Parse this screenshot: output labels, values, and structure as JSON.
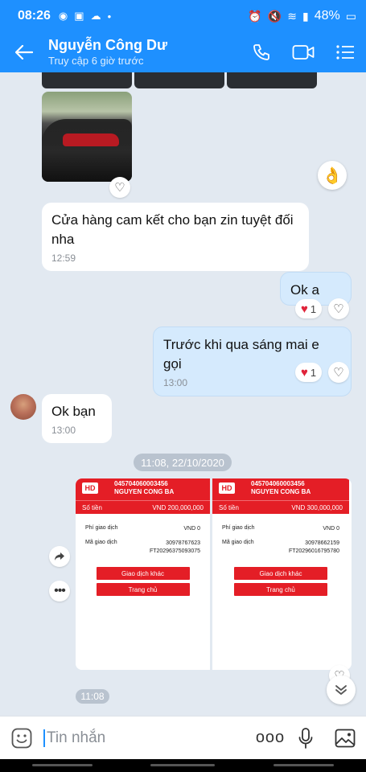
{
  "status_bar": {
    "time": "08:26",
    "battery": "48%"
  },
  "header": {
    "name": "Nguyễn Công Dư",
    "subtitle": "Truy cập 6 giờ trước"
  },
  "messages": [
    {
      "text": "Cửa hàng cam kết cho bạn zin tuyệt đối nha",
      "time": "12:59"
    },
    {
      "text": "Ok a",
      "reaction_count": "1"
    },
    {
      "text": "Trước khi qua sáng mai e gọi",
      "time": "13:00",
      "reaction_count": "1"
    },
    {
      "text": "Ok bạn",
      "time": "13:00"
    }
  ],
  "date_separator": "11:08, 22/10/2020",
  "receipts": [
    {
      "badge": "HD",
      "account": "045704060003456",
      "account_name": "NGUYEN CONG BA",
      "amount_label": "Số tiền",
      "amount": "VND  200,000,000",
      "fee_label": "Phí giao dịch",
      "fee": "VND 0",
      "code_label": "Mã giao dịch",
      "code_1": "30978767623",
      "code_2": "FT20296375093075",
      "button_1": "Giao dịch khác",
      "button_2": "Trang chủ"
    },
    {
      "badge": "HD",
      "account": "045704060003456",
      "account_name": "NGUYEN CONG BA",
      "amount_label": "Số tiền",
      "amount": "VND  300,000,000",
      "fee_label": "Phí giao dịch",
      "fee": "VND 0",
      "code_label": "Mã giao dịch",
      "code_1": "30978662159",
      "code_2": "FT20296016795780",
      "button_1": "Giao dịch khác",
      "button_2": "Trang chủ"
    }
  ],
  "image_time": "11:08",
  "input": {
    "placeholder": "Tin nhắn",
    "more": "ooo"
  },
  "colors": {
    "header": "#1e90ff",
    "chat_bg": "#e2e9f1",
    "out_bubble": "#d5eafd",
    "receipt_red": "#e41e26"
  }
}
